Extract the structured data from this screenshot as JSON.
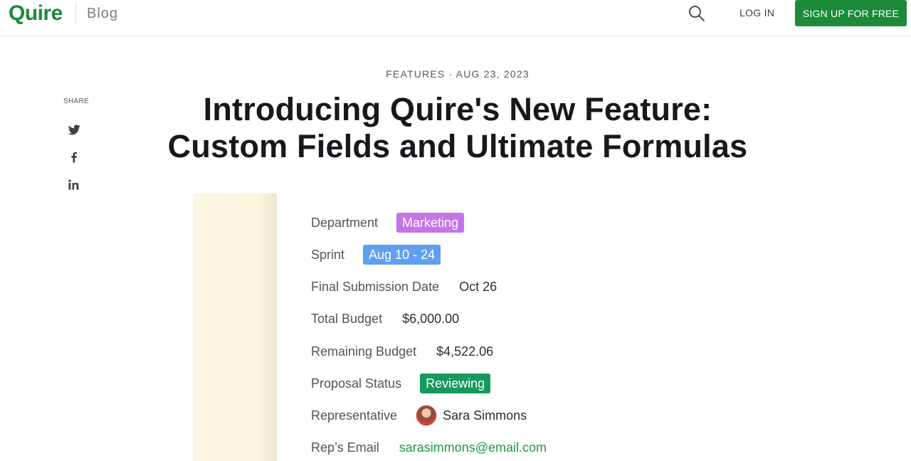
{
  "header": {
    "logo": "Quire",
    "blog": "Blog",
    "login": "LOG IN",
    "signup": "SIGN UP FOR FREE",
    "brand_color": "#1c8a3a",
    "search_icon": "search-icon"
  },
  "share": {
    "label": "SHARE",
    "icons": [
      "twitter-icon",
      "facebook-icon",
      "linkedin-icon"
    ]
  },
  "article": {
    "meta": "FEATURES · AUG 23, 2023",
    "title_line1": "Introducing Quire's New Feature:",
    "title_line2": "Custom Fields and Ultimate Formulas"
  },
  "fields": {
    "department": {
      "label": "Department",
      "value": "Marketing",
      "color": "#c574e8"
    },
    "sprint": {
      "label": "Sprint",
      "value": "Aug 10 - 24",
      "color": "#5f9ff2"
    },
    "final_submission": {
      "label": "Final Submission Date",
      "value": "Oct 26"
    },
    "total_budget": {
      "label": "Total Budget",
      "value": "$6,000.00"
    },
    "remaining_budget": {
      "label": "Remaining Budget",
      "value": "$4,522.06"
    },
    "proposal_status": {
      "label": "Proposal Status",
      "value": "Reviewing",
      "color": "#17995a"
    },
    "representative": {
      "label": "Representative",
      "value": "Sara Simmons"
    },
    "reps_email": {
      "label": "Rep’s Email",
      "value": "sarasimmons@email.com",
      "color": "#1d9a4c"
    }
  }
}
